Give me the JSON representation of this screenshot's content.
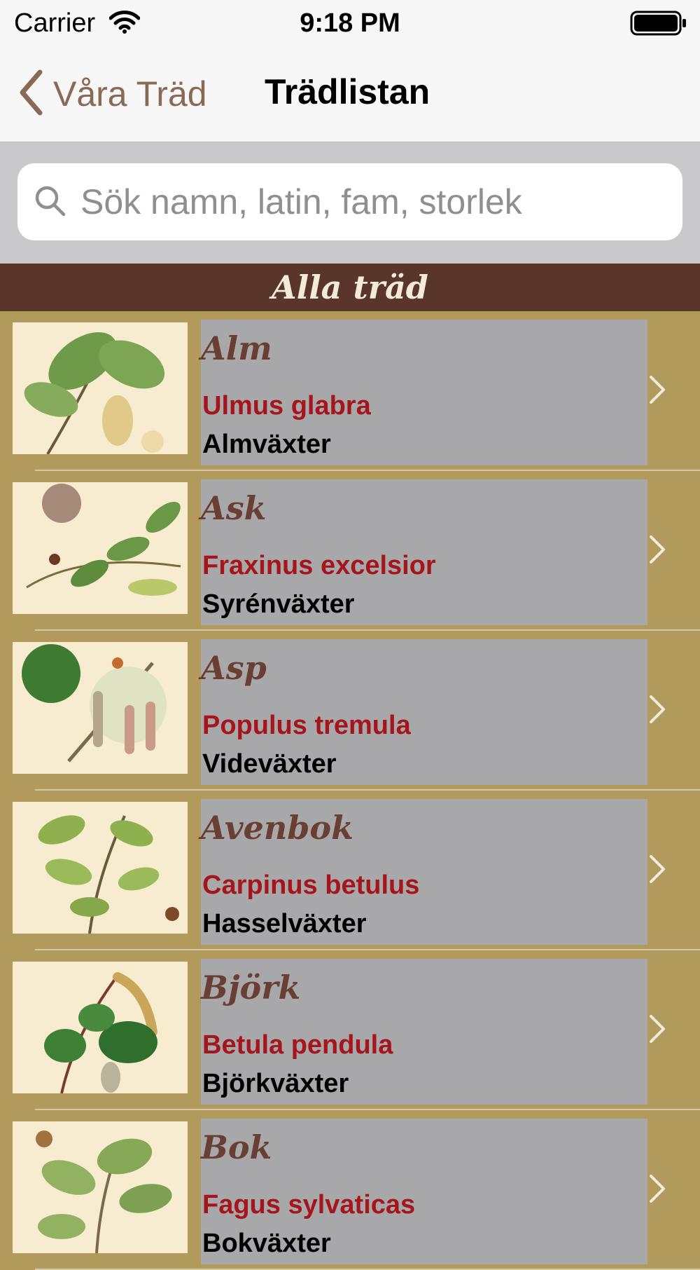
{
  "status_bar": {
    "carrier": "Carrier",
    "time": "9:18 PM"
  },
  "nav": {
    "back_label": "Våra Träd",
    "title": "Trädlistan"
  },
  "search": {
    "placeholder": "Sök namn, latin, fam, storlek",
    "value": ""
  },
  "section": {
    "title": "Alla träd"
  },
  "trees": [
    {
      "name": "Alm",
      "latin": "Ulmus glabra",
      "family": "Almväxter"
    },
    {
      "name": "Ask",
      "latin": "Fraxinus excelsior",
      "family": "Syrénväxter"
    },
    {
      "name": "Asp",
      "latin": "Populus tremula",
      "family": "Videväxter"
    },
    {
      "name": "Avenbok",
      "latin": "Carpinus betulus",
      "family": "Hasselväxter"
    },
    {
      "name": "Björk",
      "latin": "Betula pendula",
      "family": "Björkväxter"
    },
    {
      "name": "Bok",
      "latin": "Fagus sylvaticas",
      "family": "Bokväxter"
    }
  ],
  "colors": {
    "accent": "#8a6a57",
    "section_bg": "#5a352a",
    "list_bg": "#b29a5d",
    "card_bg": "#a8a8aa",
    "latin_red": "#a4161c",
    "name_brown": "#6a3f33"
  }
}
